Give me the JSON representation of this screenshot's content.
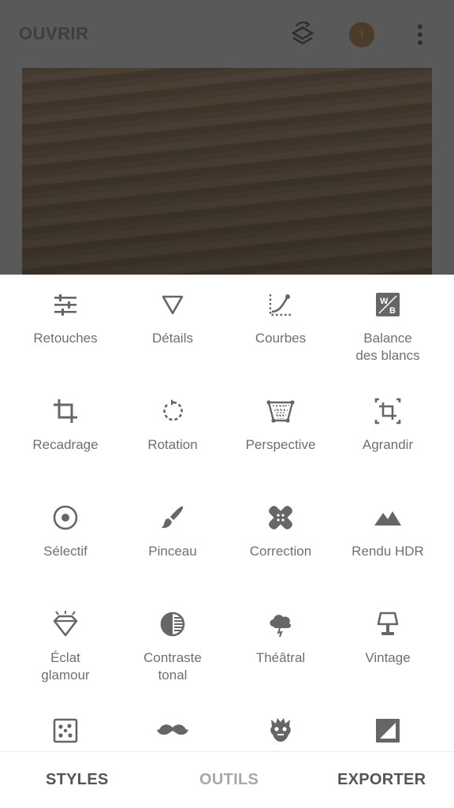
{
  "header": {
    "open_label": "OUVRIR",
    "icons": [
      "layers-swap-icon",
      "info-icon",
      "more-vert-icon"
    ]
  },
  "tools": [
    {
      "label": "Retouches",
      "icon": "tune-sliders-icon"
    },
    {
      "label": "Détails",
      "icon": "triangle-down-icon"
    },
    {
      "label": "Courbes",
      "icon": "curves-icon"
    },
    {
      "label": "Balance\ndes blancs",
      "icon": "white-balance-icon"
    },
    {
      "label": "Recadrage",
      "icon": "crop-icon"
    },
    {
      "label": "Rotation",
      "icon": "rotate-icon"
    },
    {
      "label": "Perspective",
      "icon": "perspective-icon"
    },
    {
      "label": "Agrandir",
      "icon": "expand-icon"
    },
    {
      "label": "Sélectif",
      "icon": "selective-icon"
    },
    {
      "label": "Pinceau",
      "icon": "brush-icon"
    },
    {
      "label": "Correction",
      "icon": "healing-icon"
    },
    {
      "label": "Rendu HDR",
      "icon": "hdr-mountains-icon"
    },
    {
      "label": "Éclat\nglamour",
      "icon": "diamond-glow-icon"
    },
    {
      "label": "Contraste\ntonal",
      "icon": "tonal-contrast-icon"
    },
    {
      "label": "Théâtral",
      "icon": "drama-cloud-icon"
    },
    {
      "label": "Vintage",
      "icon": "lamp-icon"
    },
    {
      "label": "",
      "icon": "dice-grunge-icon"
    },
    {
      "label": "",
      "icon": "mustache-icon"
    },
    {
      "label": "",
      "icon": "punk-face-icon"
    },
    {
      "label": "",
      "icon": "frame-icon"
    }
  ],
  "bottom_nav": {
    "styles": "STYLES",
    "outils": "OUTILS",
    "exporter": "EXPORTER"
  }
}
